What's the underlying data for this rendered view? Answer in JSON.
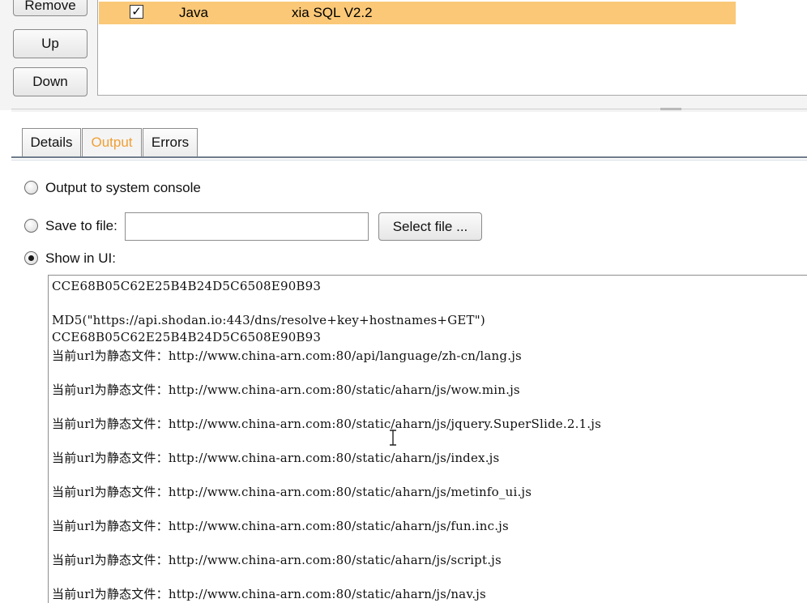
{
  "extensions_panel": {
    "buttons": {
      "remove": "Remove",
      "up": "Up",
      "down": "Down"
    },
    "selected_row": {
      "loaded": true,
      "type": "Java",
      "name": "xia SQL V2.2",
      "highlight_color": "#fac877"
    }
  },
  "tabs": [
    {
      "label": "Details",
      "active": false
    },
    {
      "label": "Output",
      "active": true
    },
    {
      "label": "Errors",
      "active": false
    }
  ],
  "output_options": {
    "console_label": "Output to system console",
    "save_label": "Save to file:",
    "file_path": "",
    "select_file_label": "Select file ...",
    "show_ui_label": "Show in UI:",
    "selected": "show_in_ui"
  },
  "output_lines": [
    "CCE68B05C62E25B4B24D5C6508E90B93",
    "",
    "MD5(\"https://api.shodan.io:443/dns/resolve+key+hostnames+GET\")",
    "CCE68B05C62E25B4B24D5C6508E90B93",
    "当前url为静态文件：http://www.china-arn.com:80/api/language/zh-cn/lang.js",
    "",
    "当前url为静态文件：http://www.china-arn.com:80/static/aharn/js/wow.min.js",
    "",
    "当前url为静态文件：http://www.china-arn.com:80/static/aharn/js/jquery.SuperSlide.2.1.js",
    "",
    "当前url为静态文件：http://www.china-arn.com:80/static/aharn/js/index.js",
    "",
    "当前url为静态文件：http://www.china-arn.com:80/static/aharn/js/metinfo_ui.js",
    "",
    "当前url为静态文件：http://www.china-arn.com:80/static/aharn/js/fun.inc.js",
    "",
    "当前url为静态文件：http://www.china-arn.com:80/static/aharn/js/script.js",
    "",
    "当前url为静态文件：http://www.china-arn.com:80/static/aharn/js/nav.js"
  ],
  "colors": {
    "active_tab_text": "#f0a035",
    "row_highlight": "#fac877"
  }
}
